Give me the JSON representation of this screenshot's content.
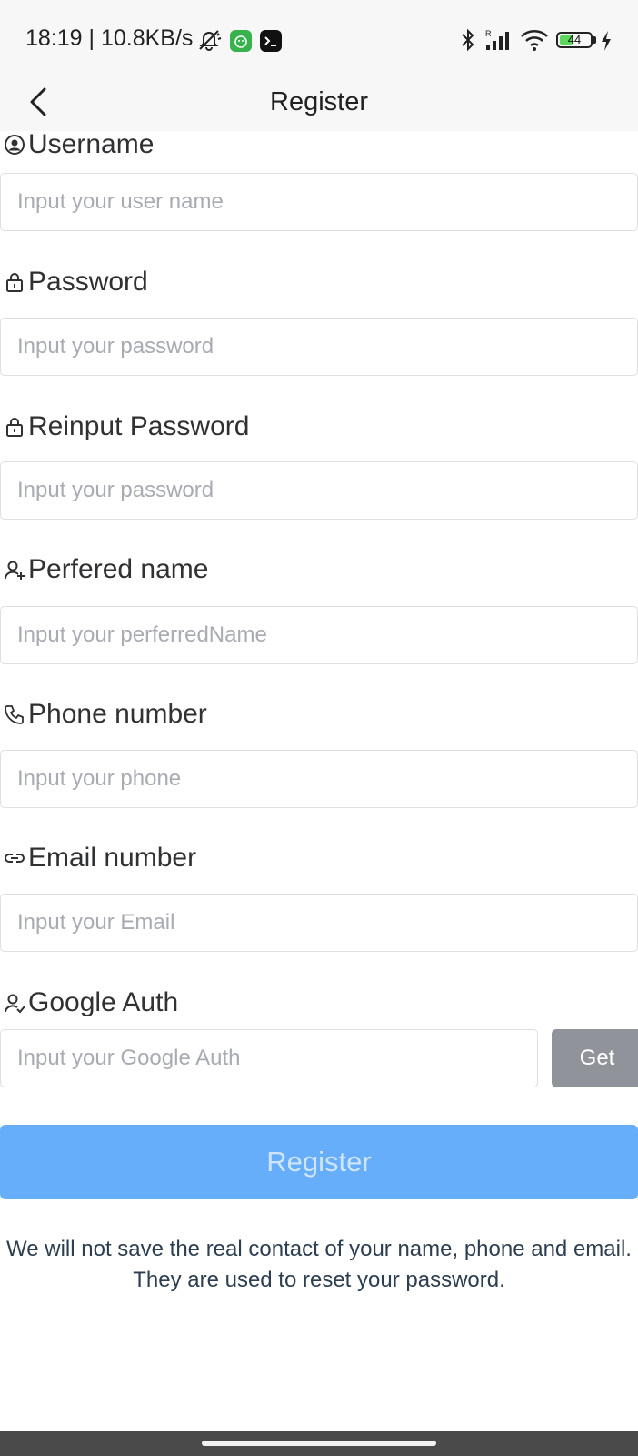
{
  "status_bar": {
    "time_text": "18:19 | 10.8KB/s",
    "battery": "44",
    "battery_fraction": 0.44
  },
  "nav": {
    "title": "Register",
    "back_icon": "chevron-left-icon"
  },
  "form": {
    "username": {
      "label": "Username",
      "placeholder": "Input your user name",
      "icon": "user-circle-icon"
    },
    "password": {
      "label": "Password",
      "placeholder": "Input your password",
      "icon": "lock-icon"
    },
    "reinput_password": {
      "label": "Reinput Password",
      "placeholder": "Input your password",
      "icon": "lock-icon"
    },
    "preferred_name": {
      "label": "Perfered name",
      "placeholder": "Input your perferredName",
      "icon": "user-add-icon"
    },
    "phone": {
      "label": "Phone number",
      "placeholder": "Input your phone",
      "icon": "phone-icon"
    },
    "email": {
      "label": "Email number",
      "placeholder": "Input your Email",
      "icon": "link-icon"
    },
    "google_auth": {
      "label": "Google Auth",
      "placeholder": "Input your Google Auth",
      "icon": "user-check-icon",
      "get_label": "Get"
    }
  },
  "register_button": "Register",
  "notice": "We will not save the real contact of your name, phone and email. They are used to reset your password.",
  "colors": {
    "primary_light": "#66adfa",
    "get_button": "#909399",
    "input_border": "#dcdfe6",
    "placeholder": "#a8abb2"
  }
}
